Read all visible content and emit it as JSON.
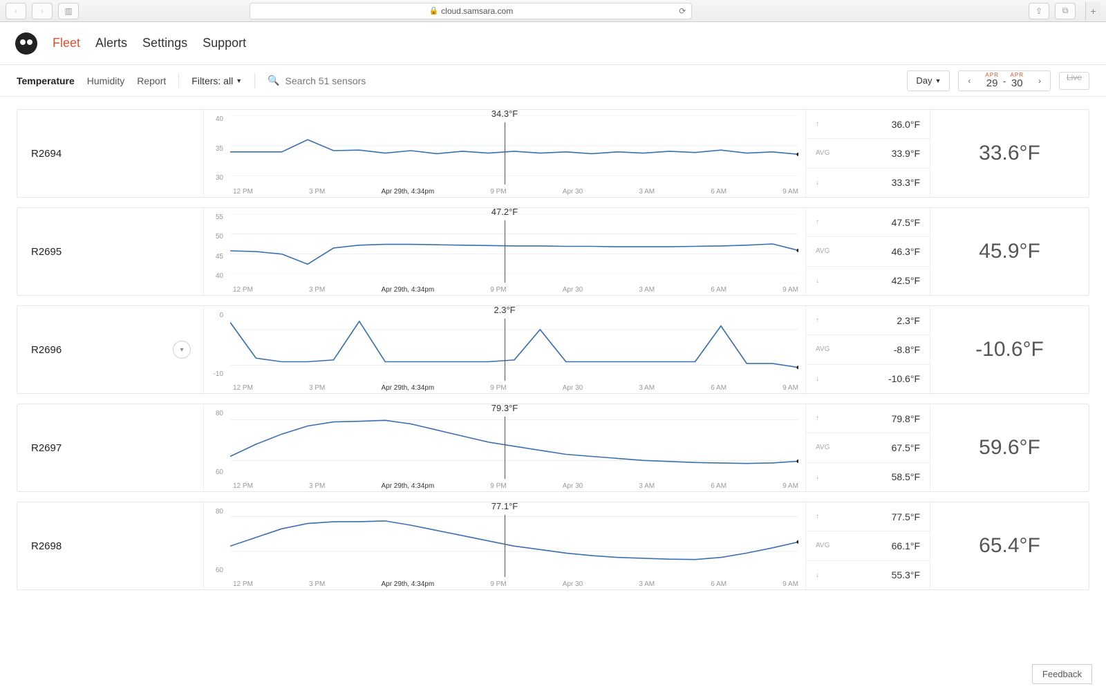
{
  "browser": {
    "url": "cloud.samsara.com"
  },
  "nav": {
    "items": [
      "Fleet",
      "Alerts",
      "Settings",
      "Support"
    ],
    "active": "Fleet"
  },
  "toolbar": {
    "tabs": [
      "Temperature",
      "Humidity",
      "Report"
    ],
    "active_tab": "Temperature",
    "filters_label": "Filters: all",
    "search_placeholder": "Search 51 sensors",
    "period_label": "Day",
    "date_from": {
      "month": "APR",
      "day": "29"
    },
    "date_to": {
      "month": "APR",
      "day": "30"
    },
    "live_label": "Live"
  },
  "hover": {
    "timestamp": "Apr 29th, 4:34pm"
  },
  "x_ticks": [
    "12 PM",
    "3 PM",
    "",
    "9 PM",
    "Apr 30",
    "3 AM",
    "6 AM",
    "9 AM"
  ],
  "stat_labels": {
    "max": "↑",
    "avg": "AVG",
    "min": "↓"
  },
  "feedback_label": "Feedback",
  "sensors": [
    {
      "name": "R2694",
      "hover_value": "34.3°F",
      "y_ticks": [
        "40",
        "35",
        "30"
      ],
      "max": "36.0°F",
      "avg": "33.9°F",
      "min": "33.3°F",
      "current": "33.6°F"
    },
    {
      "name": "R2695",
      "hover_value": "47.2°F",
      "y_ticks": [
        "55",
        "50",
        "45",
        "40"
      ],
      "max": "47.5°F",
      "avg": "46.3°F",
      "min": "42.5°F",
      "current": "45.9°F"
    },
    {
      "name": "R2696",
      "hover_value": "2.3°F",
      "y_ticks": [
        "0",
        "-10"
      ],
      "max": "2.3°F",
      "avg": "-8.8°F",
      "min": "-10.6°F",
      "current": "-10.6°F",
      "expandable": true
    },
    {
      "name": "R2697",
      "hover_value": "79.3°F",
      "y_ticks": [
        "80",
        "60"
      ],
      "max": "79.8°F",
      "avg": "67.5°F",
      "min": "58.5°F",
      "current": "59.6°F"
    },
    {
      "name": "R2698",
      "hover_value": "77.1°F",
      "y_ticks": [
        "80",
        "60"
      ],
      "max": "77.5°F",
      "avg": "66.1°F",
      "min": "55.3°F",
      "current": "65.4°F"
    }
  ],
  "chart_data": [
    {
      "type": "line",
      "sensor": "R2694",
      "title": "R2694 Temperature",
      "ylabel": "°F",
      "ylim": [
        30,
        40
      ],
      "x": [
        "12 PM",
        "1 PM",
        "2 PM",
        "3 PM",
        "4 PM",
        "4:34 PM",
        "5 PM",
        "6 PM",
        "7 PM",
        "8 PM",
        "9 PM",
        "10 PM",
        "11 PM",
        "Apr 30",
        "1 AM",
        "2 AM",
        "3 AM",
        "4 AM",
        "5 AM",
        "6 AM",
        "7 AM",
        "8 AM",
        "9 AM"
      ],
      "values": [
        34.0,
        34.0,
        34.0,
        36.0,
        34.2,
        34.3,
        33.8,
        34.2,
        33.7,
        34.1,
        33.8,
        34.1,
        33.8,
        34.0,
        33.7,
        34.0,
        33.8,
        34.1,
        33.9,
        34.3,
        33.8,
        34.0,
        33.6
      ]
    },
    {
      "type": "line",
      "sensor": "R2695",
      "title": "R2695 Temperature",
      "ylabel": "°F",
      "ylim": [
        40,
        55
      ],
      "x": [
        "12 PM",
        "1 PM",
        "2 PM",
        "3 PM",
        "4 PM",
        "4:34 PM",
        "5 PM",
        "6 PM",
        "7 PM",
        "8 PM",
        "9 PM",
        "10 PM",
        "11 PM",
        "Apr 30",
        "1 AM",
        "2 AM",
        "3 AM",
        "4 AM",
        "5 AM",
        "6 AM",
        "7 AM",
        "8 AM",
        "9 AM"
      ],
      "values": [
        45.8,
        45.6,
        45.0,
        42.5,
        46.5,
        47.2,
        47.4,
        47.4,
        47.3,
        47.2,
        47.1,
        47.0,
        47.0,
        46.9,
        46.9,
        46.8,
        46.8,
        46.8,
        46.9,
        47.0,
        47.2,
        47.5,
        45.9
      ]
    },
    {
      "type": "line",
      "sensor": "R2696",
      "title": "R2696 Temperature",
      "ylabel": "°F",
      "ylim": [
        -12,
        5
      ],
      "x": [
        "12 PM",
        "1 PM",
        "2 PM",
        "3 PM",
        "4 PM",
        "4:34 PM",
        "5 PM",
        "6 PM",
        "7 PM",
        "8 PM",
        "9 PM",
        "10 PM",
        "11 PM",
        "Apr 30",
        "1 AM",
        "2 AM",
        "3 AM",
        "4 AM",
        "5 AM",
        "6 AM",
        "7 AM",
        "8 AM",
        "9 AM"
      ],
      "values": [
        2.0,
        -8.0,
        -9.0,
        -9.0,
        -8.5,
        2.3,
        -9.0,
        -9.0,
        -9.0,
        -9.0,
        -9.0,
        -8.5,
        0.0,
        -9.0,
        -9.0,
        -9.0,
        -9.0,
        -9.0,
        -9.0,
        1.0,
        -9.5,
        -9.5,
        -10.6
      ]
    },
    {
      "type": "line",
      "sensor": "R2697",
      "title": "R2697 Temperature",
      "ylabel": "°F",
      "ylim": [
        55,
        85
      ],
      "x": [
        "12 PM",
        "1 PM",
        "2 PM",
        "3 PM",
        "4 PM",
        "4:34 PM",
        "5 PM",
        "6 PM",
        "7 PM",
        "8 PM",
        "9 PM",
        "10 PM",
        "11 PM",
        "Apr 30",
        "1 AM",
        "2 AM",
        "3 AM",
        "4 AM",
        "5 AM",
        "6 AM",
        "7 AM",
        "8 AM",
        "9 AM"
      ],
      "values": [
        62.0,
        68.0,
        73.0,
        77.0,
        79.0,
        79.3,
        79.8,
        78.0,
        75.0,
        72.0,
        69.0,
        67.0,
        65.0,
        63.0,
        62.0,
        61.0,
        60.0,
        59.5,
        59.0,
        58.7,
        58.5,
        58.8,
        59.6
      ]
    },
    {
      "type": "line",
      "sensor": "R2698",
      "title": "R2698 Temperature",
      "ylabel": "°F",
      "ylim": [
        50,
        85
      ],
      "x": [
        "12 PM",
        "1 PM",
        "2 PM",
        "3 PM",
        "4 PM",
        "4:34 PM",
        "5 PM",
        "6 PM",
        "7 PM",
        "8 PM",
        "9 PM",
        "10 PM",
        "11 PM",
        "Apr 30",
        "1 AM",
        "2 AM",
        "3 AM",
        "4 AM",
        "5 AM",
        "6 AM",
        "7 AM",
        "8 AM",
        "9 AM"
      ],
      "values": [
        63.0,
        68.0,
        73.0,
        76.0,
        77.0,
        77.1,
        77.5,
        75.0,
        72.0,
        69.0,
        66.0,
        63.0,
        61.0,
        59.0,
        57.5,
        56.5,
        56.0,
        55.5,
        55.3,
        56.5,
        59.0,
        62.0,
        65.4
      ]
    }
  ]
}
